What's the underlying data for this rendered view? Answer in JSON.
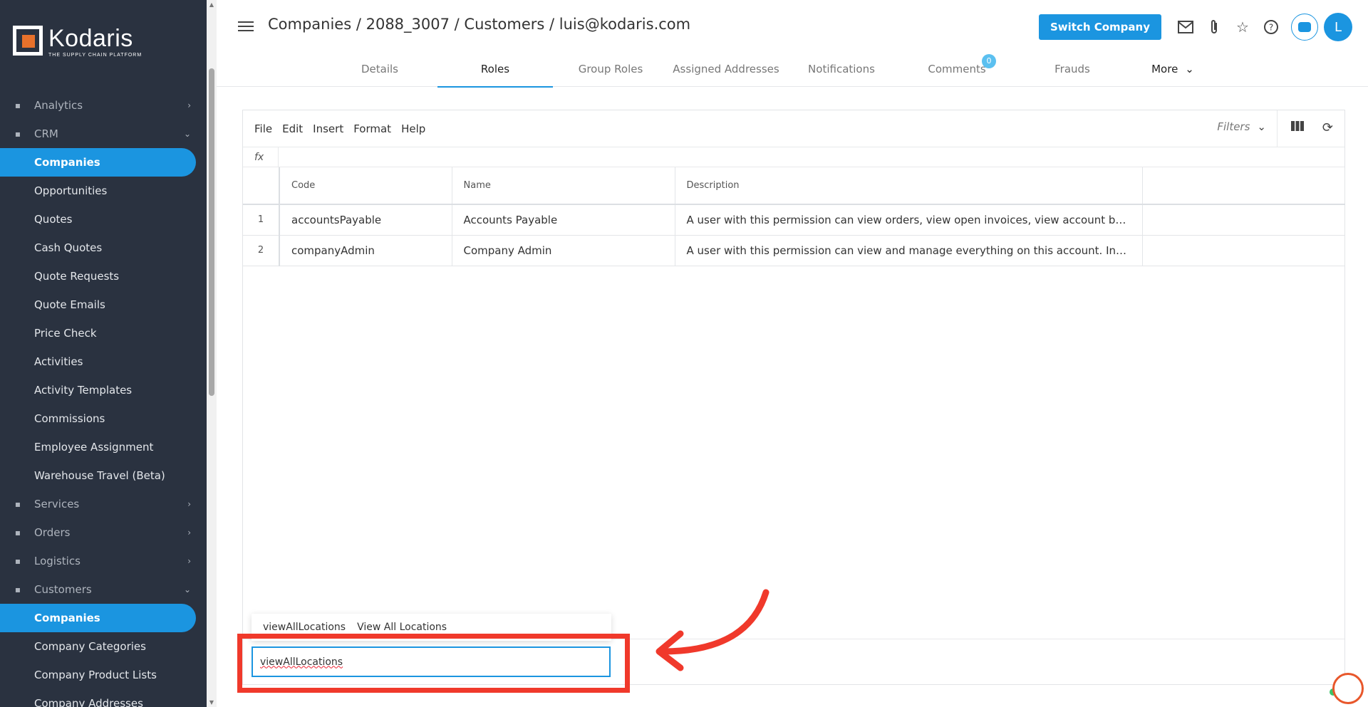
{
  "brand": {
    "name": "Kodaris",
    "tagline": "THE SUPPLY CHAIN PLATFORM"
  },
  "sidebar": {
    "items": [
      {
        "label": "Analytics",
        "type": "parent",
        "icon": "analytics-icon",
        "chevron": "›"
      },
      {
        "label": "CRM",
        "type": "parent",
        "icon": "crm-icon",
        "chevron": "⌄"
      },
      {
        "label": "Companies",
        "type": "child",
        "active": true
      },
      {
        "label": "Opportunities",
        "type": "child"
      },
      {
        "label": "Quotes",
        "type": "child"
      },
      {
        "label": "Cash Quotes",
        "type": "child"
      },
      {
        "label": "Quote Requests",
        "type": "child"
      },
      {
        "label": "Quote Emails",
        "type": "child"
      },
      {
        "label": "Price Check",
        "type": "child"
      },
      {
        "label": "Activities",
        "type": "child"
      },
      {
        "label": "Activity Templates",
        "type": "child"
      },
      {
        "label": "Commissions",
        "type": "child"
      },
      {
        "label": "Employee Assignment",
        "type": "child"
      },
      {
        "label": "Warehouse Travel (Beta)",
        "type": "child"
      },
      {
        "label": "Services",
        "type": "parent",
        "icon": "services-icon",
        "chevron": "›"
      },
      {
        "label": "Orders",
        "type": "parent",
        "icon": "orders-icon",
        "chevron": "›"
      },
      {
        "label": "Logistics",
        "type": "parent",
        "icon": "logistics-icon",
        "chevron": "›"
      },
      {
        "label": "Customers",
        "type": "parent",
        "icon": "customers-icon",
        "chevron": "⌄"
      },
      {
        "label": "Companies",
        "type": "child",
        "active": true
      },
      {
        "label": "Company Categories",
        "type": "child"
      },
      {
        "label": "Company Product Lists",
        "type": "child"
      },
      {
        "label": "Company Addresses",
        "type": "child"
      }
    ]
  },
  "header": {
    "breadcrumb": "Companies / 2088_3007 / Customers / luis@kodaris.com",
    "switch_company": "Switch Company",
    "avatar_initial": "L",
    "tabs": [
      {
        "label": "Details"
      },
      {
        "label": "Roles",
        "active": true
      },
      {
        "label": "Group Roles"
      },
      {
        "label": "Assigned Addresses"
      },
      {
        "label": "Notifications"
      },
      {
        "label": "Comments",
        "badge": "0"
      },
      {
        "label": "Frauds"
      },
      {
        "label": "More"
      }
    ]
  },
  "sheet": {
    "menu": [
      "File",
      "Edit",
      "Insert",
      "Format",
      "Help"
    ],
    "filters_label": "Filters",
    "fx_label": "fx",
    "columns": [
      "Code",
      "Name",
      "Description"
    ],
    "rows": [
      {
        "num": "1",
        "code": "accountsPayable",
        "name": "Accounts Payable",
        "description": "A user with this permission can view orders, view open invoices, view account balances, and m..."
      },
      {
        "num": "2",
        "code": "companyAdmin",
        "name": "Company Admin",
        "description": "A user with this permission can view and manage everything on this account. Including but not ..."
      }
    ]
  },
  "autocomplete": {
    "suggestion_code": "viewAllLocations",
    "suggestion_name": "View All Locations",
    "input_value": "viewAllLocations"
  },
  "colors": {
    "accent": "#1b95e0",
    "sidebar_bg": "#2a3240",
    "highlight": "#f0392b"
  }
}
